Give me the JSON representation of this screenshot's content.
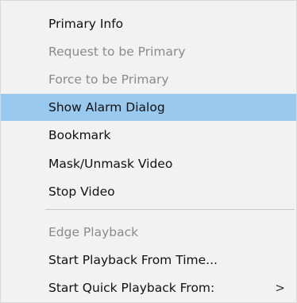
{
  "context_menu": {
    "items": [
      {
        "label": "Primary Info",
        "enabled": true,
        "highlighted": false
      },
      {
        "label": "Request to be Primary",
        "enabled": false,
        "highlighted": false
      },
      {
        "label": "Force to be Primary",
        "enabled": false,
        "highlighted": false
      },
      {
        "label": "Show Alarm Dialog",
        "enabled": true,
        "highlighted": true
      },
      {
        "label": "Bookmark",
        "enabled": true,
        "highlighted": false
      },
      {
        "label": "Mask/Unmask Video",
        "enabled": true,
        "highlighted": false
      },
      {
        "label": "Stop Video",
        "enabled": true,
        "highlighted": false
      },
      {
        "label": "Edge Playback",
        "enabled": false,
        "highlighted": false
      },
      {
        "label": "Start Playback From Time...",
        "enabled": true,
        "highlighted": false
      },
      {
        "label": "Start Quick Playback From:",
        "enabled": true,
        "highlighted": false,
        "submenu_arrow": ">"
      }
    ]
  },
  "colors": {
    "highlight": "#99c9ef",
    "disabled_text": "#8a8a8a",
    "background": "#f2f2f2"
  }
}
